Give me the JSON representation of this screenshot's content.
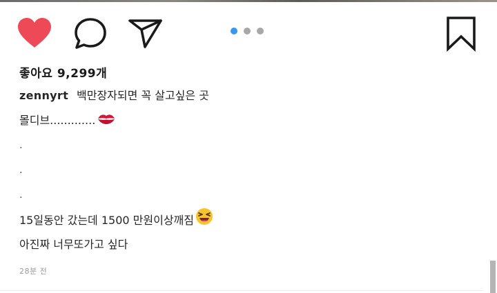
{
  "post": {
    "likes_text": "좋아요 9,299개",
    "username": "zennyrt",
    "caption_lines": [
      "백만장자되면 꼭 살고싶은 곳",
      "몰디브.............",
      ".",
      ".",
      ".",
      "15일동안 갔는데 1500 만원이상깨짐",
      "아진짜 너무또가고 싶다"
    ],
    "timestamp": "28분 전",
    "carousel": {
      "count": 3,
      "active_index": 0
    }
  },
  "icons": {
    "like": "heart-icon",
    "comment": "comment-bubble-icon",
    "share": "paper-plane-icon",
    "save": "bookmark-icon",
    "lips": "kiss-mark-emoji",
    "laugh": "squinting-laughing-face-emoji"
  },
  "colors": {
    "like_active": "#ed4956",
    "carousel_active": "#3897f0",
    "carousel_inactive": "#a8a8a8",
    "timestamp": "#9a9a9a"
  }
}
